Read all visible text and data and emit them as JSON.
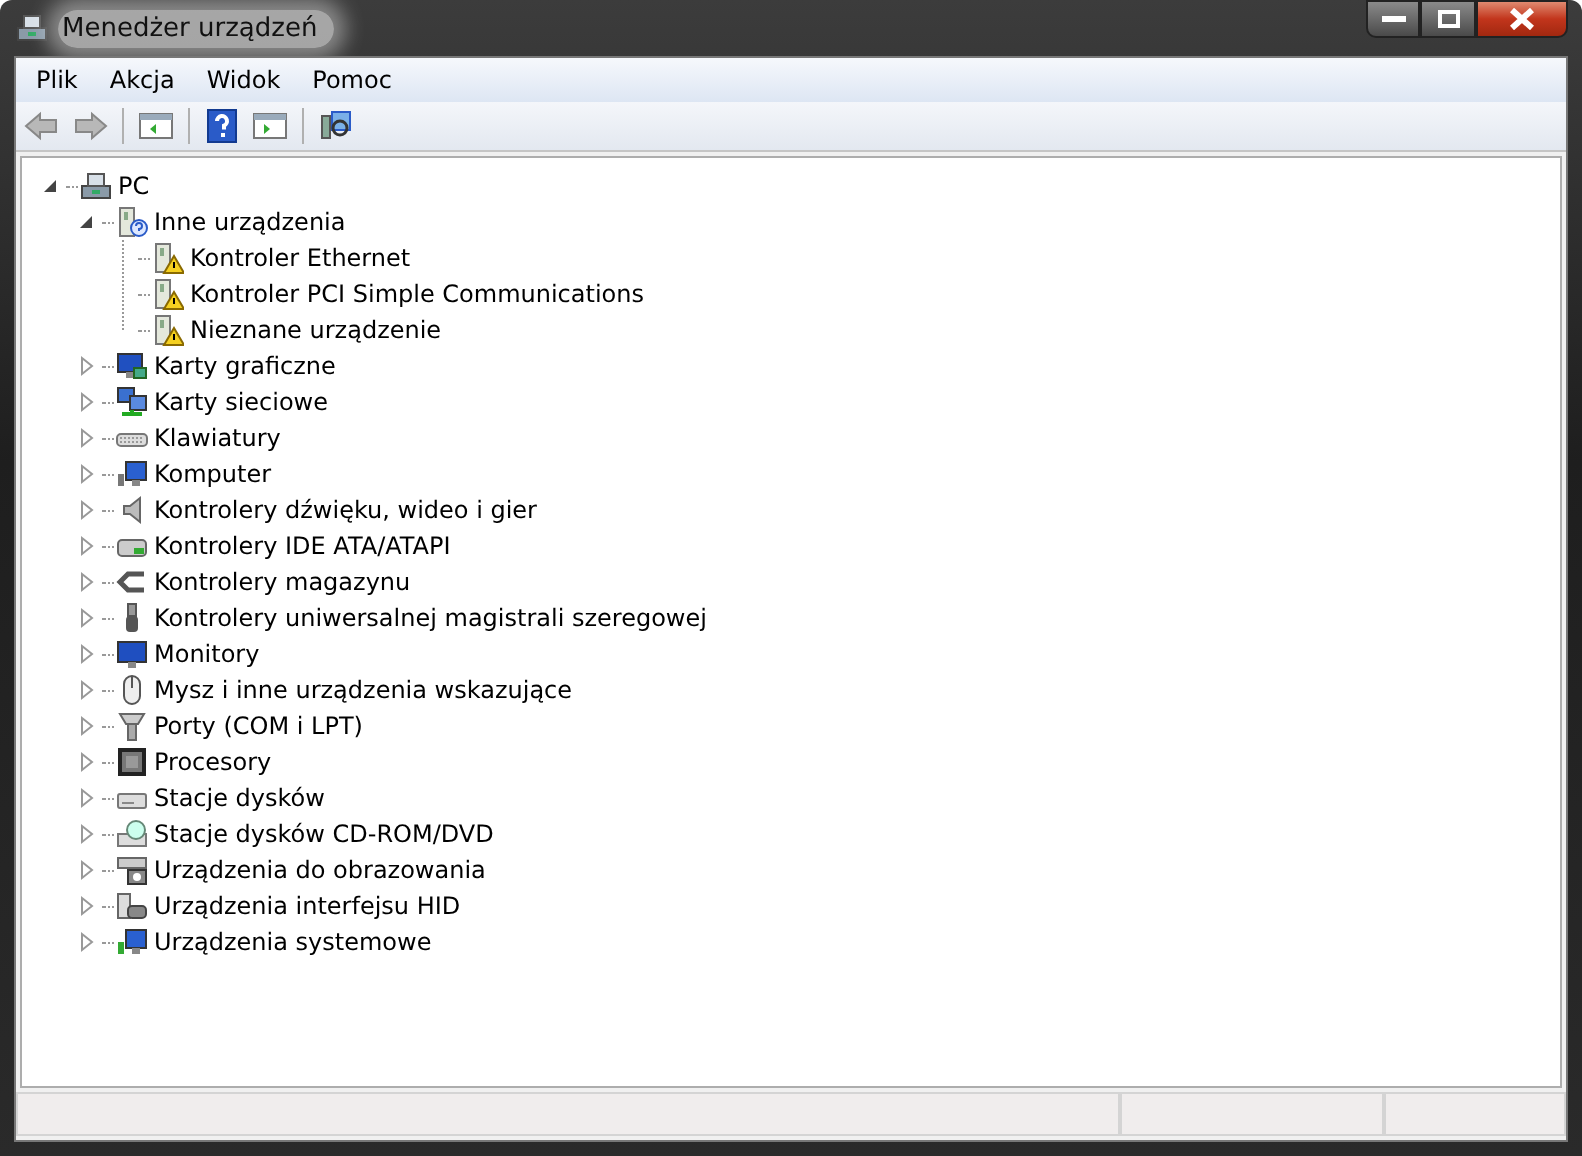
{
  "window": {
    "title": "Menedżer urządzeń"
  },
  "menu": [
    "Plik",
    "Akcja",
    "Widok",
    "Pomoc"
  ],
  "tree": [
    {
      "label": "PC",
      "expanded": true,
      "children": [
        {
          "label": "Inne urządzenia",
          "expanded": true,
          "children": [
            {
              "label": "Kontroler Ethernet",
              "warning": true
            },
            {
              "label": "Kontroler PCI Simple Communications",
              "warning": true
            },
            {
              "label": "Nieznane urządzenie",
              "warning": true
            }
          ]
        },
        {
          "label": "Karty graficzne",
          "expanded": false
        },
        {
          "label": "Karty sieciowe",
          "expanded": false
        },
        {
          "label": "Klawiatury",
          "expanded": false
        },
        {
          "label": "Komputer",
          "expanded": false
        },
        {
          "label": "Kontrolery dźwięku, wideo i gier",
          "expanded": false
        },
        {
          "label": "Kontrolery IDE ATA/ATAPI",
          "expanded": false
        },
        {
          "label": "Kontrolery magazynu",
          "expanded": false
        },
        {
          "label": "Kontrolery uniwersalnej magistrali szeregowej",
          "expanded": false
        },
        {
          "label": "Monitory",
          "expanded": false
        },
        {
          "label": "Mysz i inne urządzenia wskazujące",
          "expanded": false
        },
        {
          "label": "Porty (COM i LPT)",
          "expanded": false
        },
        {
          "label": "Procesory",
          "expanded": false
        },
        {
          "label": "Stacje dysków",
          "expanded": false
        },
        {
          "label": "Stacje dysków CD-ROM/DVD",
          "expanded": false
        },
        {
          "label": "Urządzenia do obrazowania",
          "expanded": false
        },
        {
          "label": "Urządzenia interfejsu HID",
          "expanded": false
        },
        {
          "label": "Urządzenia systemowe",
          "expanded": false
        }
      ]
    }
  ]
}
